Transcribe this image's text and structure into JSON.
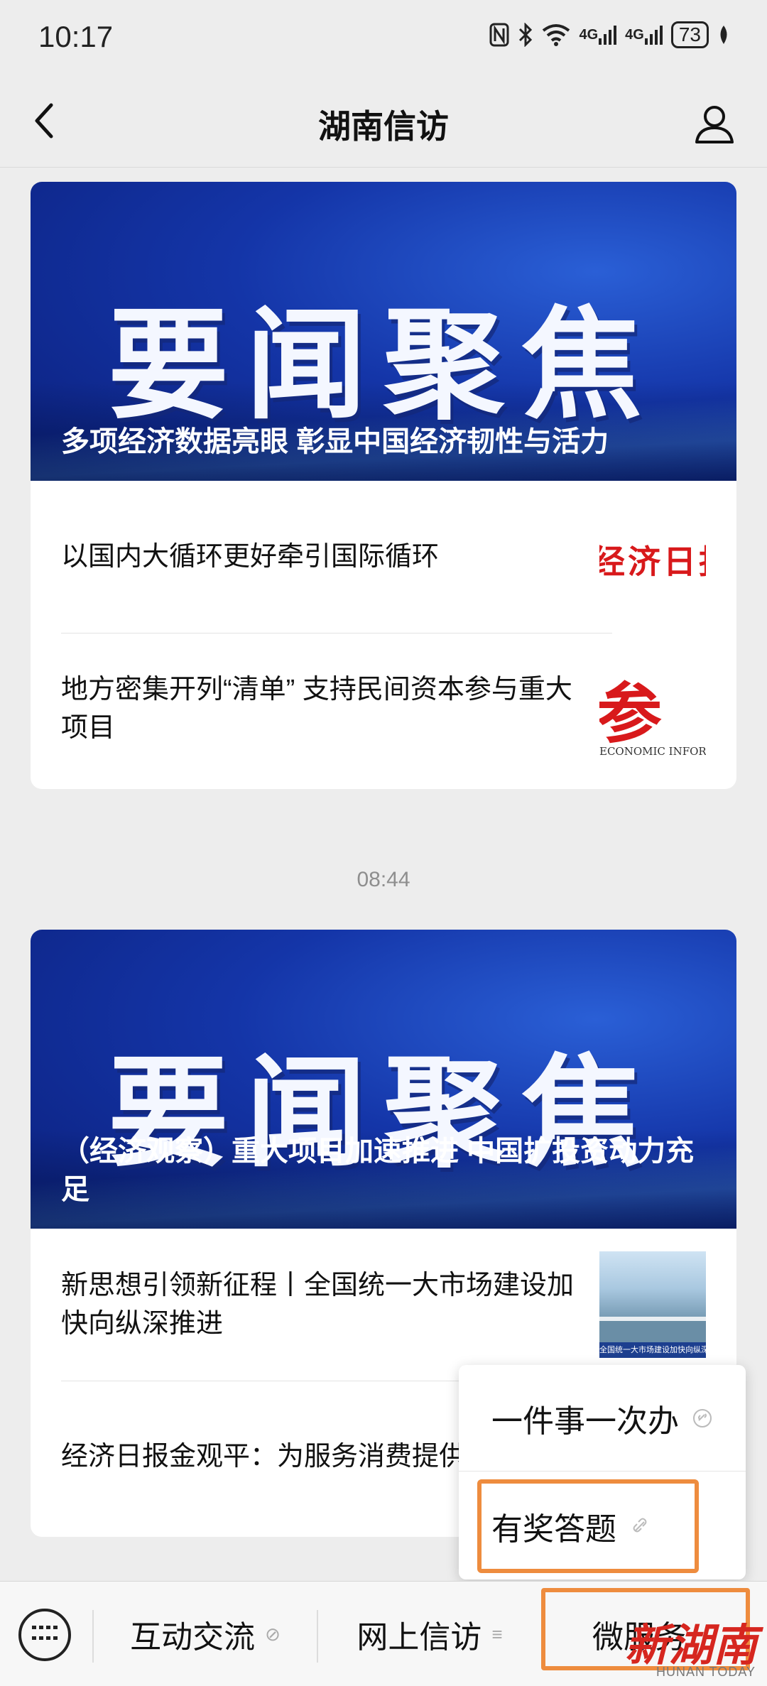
{
  "status_bar": {
    "time": "10:17",
    "signal_1": "4G",
    "signal_2": "4G",
    "battery": "73"
  },
  "nav": {
    "title": "湖南信访"
  },
  "articles": [
    {
      "banner_heading": "要闻聚焦",
      "banner_caption": "多项经济数据亮眼 彰显中国经济韧性与活力",
      "items": [
        {
          "title": "以国内大循环更好牵引国际循环",
          "thumb_text": "经济日报"
        },
        {
          "title": "地方密集开列“清单” 支持民间资本参与重大项目",
          "thumb_text": "参",
          "thumb_sub": "ECONOMIC INFORMATION"
        }
      ]
    },
    {
      "banner_heading": "要闻聚焦",
      "banner_caption": "（经济观察）重大项目加速推进 中国扩投资动力充足",
      "items": [
        {
          "title": "新思想引领新征程丨全国统一大市场建设加快向纵深推进",
          "thumb_text": "全国统一大市场建设加快向纵深推进"
        },
        {
          "title": "经济日报金观平：为服务消费提供金融支持"
        }
      ]
    }
  ],
  "timestamp": "08:44",
  "popup_menu": {
    "items": [
      "一件事一次办",
      "有奖答题"
    ]
  },
  "bottom_menu": {
    "tabs": [
      "互动交流",
      "网上信访",
      "微服务"
    ],
    "link_glyph": "⊘",
    "list_glyph": "≡"
  },
  "watermark": {
    "text": "新湖南",
    "sub": "HUNAN TODAY"
  }
}
